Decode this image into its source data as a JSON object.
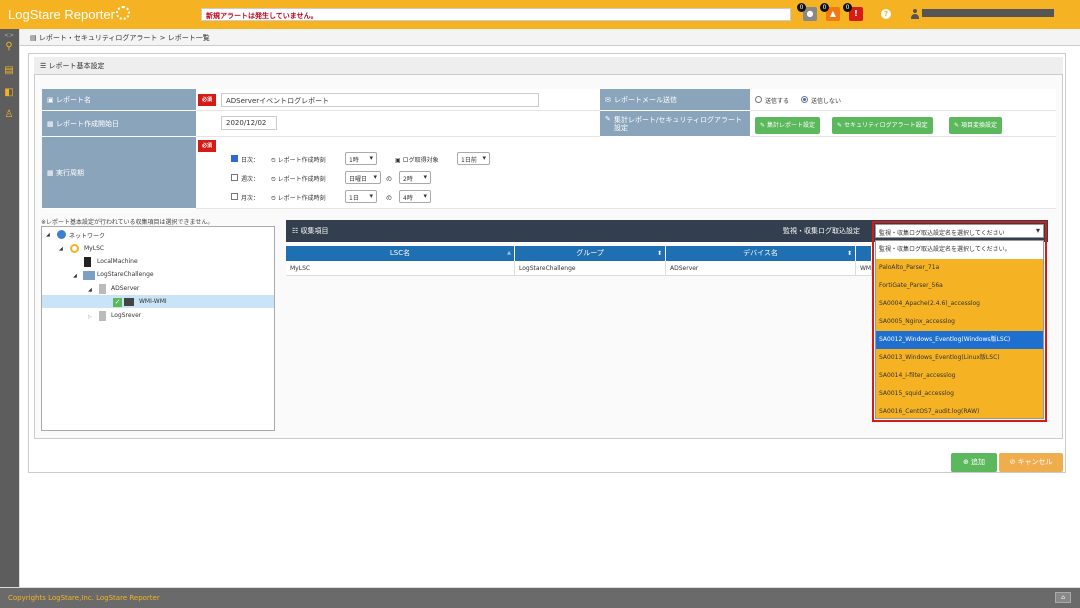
{
  "colors": {
    "brand": "#f5b324",
    "required": "#d51b16",
    "label_bg": "#8aa5bb",
    "header_dark": "#333f4f",
    "column_blue": "#1f6fb3",
    "button_green": "#5cb85c",
    "button_orange": "#f0ad4e",
    "highlight": "#1e6fd0"
  },
  "topbar": {
    "app_title": "LogStare Reporter",
    "alert_text": "新規アラートは発生していません。",
    "badges": [
      "0",
      "0",
      "0"
    ],
    "user_name": "■■■■■■■■■■■■■■■■■■■■"
  },
  "sidebar": {
    "icons": [
      "search-icon",
      "report-icon",
      "tag-icon",
      "users-icon"
    ]
  },
  "breadcrumb": {
    "text": "レポート・セキュリティログアラート > レポート一覧"
  },
  "panel": {
    "title": "レポート基本設定"
  },
  "form": {
    "required": "必須",
    "report_name_label": "レポート名",
    "report_name_value": "ADServerイベントログレポート",
    "start_date_label": "レポート作成開始日",
    "start_date_value": "2020/12/02",
    "schedule_label": "実行周期",
    "mail_label": "レポートメール送信",
    "mail_send": "送信する",
    "mail_nosend": "送信しない",
    "aggregate_label": "集計レポート/セキュリティログアラート設定",
    "btn_aggregate": "集計レポート設定",
    "btn_security": "セキュリティログアラート設定",
    "btn_item": "項目変換設定",
    "daily": "日次：",
    "weekly": "週次：",
    "monthly": "月次：",
    "create_time": "レポート作成時刻",
    "log_target": "ログ取得対象",
    "of": "の",
    "daily_time": "1時",
    "daily_target": "1日前",
    "weekly_day": "日曜日",
    "weekly_time": "2時",
    "monthly_day": "1日",
    "monthly_time": "4時"
  },
  "tree": {
    "note": "※レポート基本設定が行われている収集項目は選択できません。",
    "nodes": [
      "ネットワーク",
      "MyLSC",
      "LocalMachine",
      "LogStareChallenge",
      "ADServer",
      "WMI-WMI",
      "LogSrever"
    ]
  },
  "grid": {
    "title": "収集項目",
    "filter_label": "監視・収集ログ取込設定",
    "columns": [
      "LSC名",
      "グループ",
      "デバイス名"
    ],
    "rows": [
      [
        "MyLSC",
        "LogStareChallenge",
        "ADServer",
        "WM"
      ]
    ]
  },
  "dropdown": {
    "selected": "監視・収集ログ取込設定名を選択してください",
    "options": [
      "監視・収集ログ取込設定名を選択してください。",
      "PaloAlto_Parser_71a",
      "FortiGate_Parser_56a",
      "SA0004_Apache(2.4.6)_accesslog",
      "SA0005_Nginx_accesslog",
      "SA0012_Windows_Eventlog(Windows版LSC)",
      "SA0013_Windows_Eventlog(Linux版LSC)",
      "SA0014_i-filter_accesslog",
      "SA0015_squid_accesslog",
      "SA0016_CentOS7_audit.log(RAW)"
    ]
  },
  "actions": {
    "add": "追加",
    "cancel": "キャンセル"
  },
  "footer": {
    "copyright": "Copyrights LogStare,Inc.  LogStare Reporter"
  }
}
